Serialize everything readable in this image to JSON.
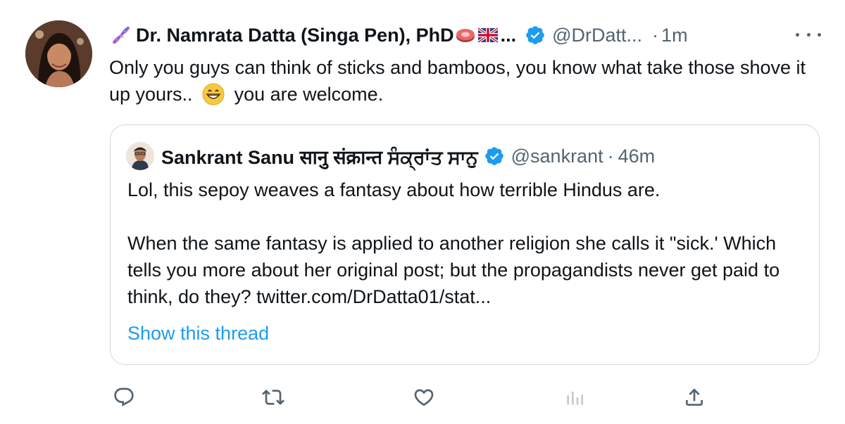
{
  "tweet": {
    "author": {
      "display_name": "Dr. Namrata Datta (Singa Pen), PhD",
      "truncation": "...",
      "handle": "@DrDatt...",
      "separator": "·",
      "time": "1m",
      "avatar_icon": "profile-photo",
      "name_icons": [
        "dna-icon",
        "meat-emoji-icon",
        "uk-flag-icon"
      ],
      "verified": true
    },
    "text_before_emoji": "Only you guys can think of sticks and bamboos, you know what take those shove it up yours..",
    "emoji": "grinning-face-icon",
    "text_after_emoji": "you are welcome.",
    "more_icon": "more-icon"
  },
  "quote": {
    "author": {
      "display_name": "Sankrant Sanu सानु संक्रान्त ਸੰਕ੍ਰਾਂਤ ਸਾਨੁ",
      "handle": "@sankrant",
      "separator": "·",
      "time": "46m",
      "verified": true
    },
    "paragraph1": "Lol, this sepoy weaves a fantasy about how terrible Hindus are.",
    "paragraph2": "When the same fantasy is applied to another religion she calls it \"sick.' Which tells you more about her original post; but the propagandists never get paid to think, do they? twitter.com/DrDatta01/stat...",
    "show_thread": "Show this thread"
  },
  "actions": [
    "reply-icon",
    "retweet-icon",
    "like-icon",
    "analytics-icon",
    "share-icon"
  ],
  "colors": {
    "text": "#0f1419",
    "secondary": "#536471",
    "link": "#1d9bf0",
    "verified": "#1d9bf0",
    "border": "#cfd9de"
  }
}
